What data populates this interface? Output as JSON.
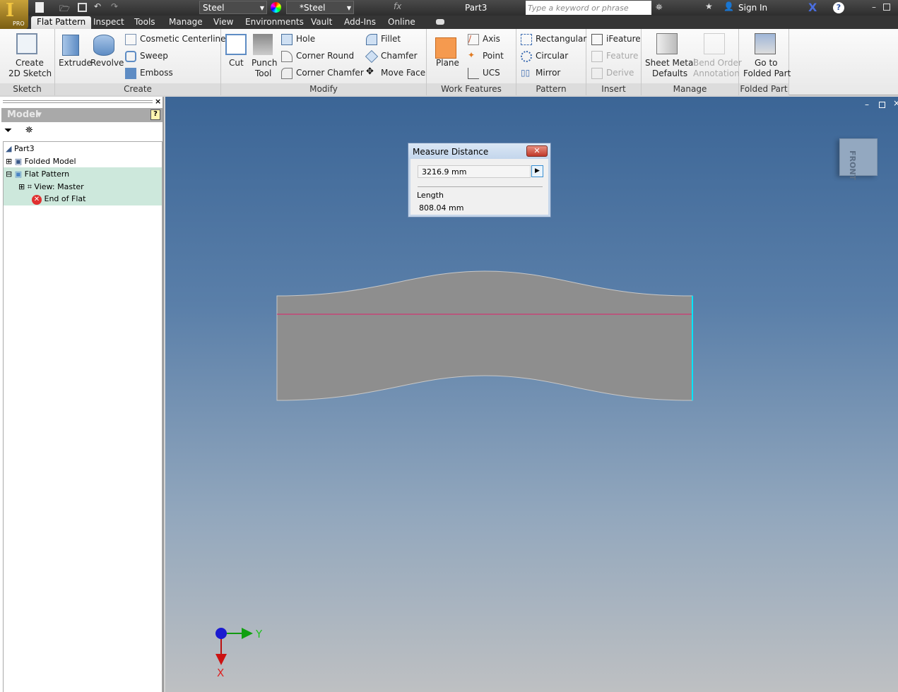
{
  "app": {
    "title": "Part3",
    "logo_badge": "PRO",
    "search_placeholder": "Type a keyword or phrase",
    "sign_in": "Sign In",
    "material": "Steel",
    "appearance": "*Steel"
  },
  "tabs": [
    {
      "label": "Flat Pattern",
      "active": true
    },
    {
      "label": "Inspect"
    },
    {
      "label": "Tools"
    },
    {
      "label": "Manage"
    },
    {
      "label": "View"
    },
    {
      "label": "Environments"
    },
    {
      "label": "Vault"
    },
    {
      "label": "Add-Ins"
    },
    {
      "label": "Online"
    }
  ],
  "ribbon": {
    "sketch": {
      "label": "Sketch",
      "create_sketch": [
        "Create",
        "2D Sketch"
      ]
    },
    "create": {
      "label": "Create",
      "extrude": "Extrude",
      "revolve": "Revolve",
      "cosmetic": "Cosmetic Centerline",
      "sweep": "Sweep",
      "emboss": "Emboss"
    },
    "modify": {
      "label": "Modify",
      "cut": "Cut",
      "punch": [
        "Punch",
        "Tool"
      ],
      "hole": "Hole",
      "corner_round": "Corner Round",
      "corner_chamfer": "Corner Chamfer",
      "fillet": "Fillet",
      "chamfer": "Chamfer",
      "move_face": "Move Face"
    },
    "work": {
      "label": "Work Features",
      "plane": "Plane",
      "axis": "Axis",
      "point": "Point",
      "ucs": "UCS"
    },
    "pattern": {
      "label": "Pattern",
      "rect": "Rectangular",
      "circ": "Circular",
      "mirror": "Mirror"
    },
    "insert": {
      "label": "Insert",
      "ifeature": "iFeature",
      "feature": "Feature",
      "derive": "Derive"
    },
    "manage": {
      "label": "Manage",
      "smd": [
        "Sheet Metal",
        "Defaults"
      ],
      "bend": [
        "Bend Order",
        "Annotation"
      ]
    },
    "folded": {
      "label": "Folded Part",
      "goto": [
        "Go to",
        "Folded Part"
      ]
    }
  },
  "browser": {
    "header": "Model",
    "items": [
      {
        "label": "Part3"
      },
      {
        "label": "Folded Model"
      },
      {
        "label": "Flat Pattern",
        "selected": true
      },
      {
        "label": "View: Master",
        "selected": true
      },
      {
        "label": "End of Flat",
        "selected": true
      }
    ]
  },
  "measure": {
    "title": "Measure Distance",
    "value": "3216.9 mm",
    "result_label": "Length",
    "result": "808.04 mm"
  },
  "viewcube": {
    "face": "FRONT"
  },
  "triad": {
    "x": "X",
    "y": "Y"
  },
  "colors": {
    "viewport_top": "#3b6596",
    "viewport_bottom": "#bec0c2",
    "part": "#8e8e8e",
    "measure_line": "#e0206a",
    "edge_highlight": "#00e5ff"
  }
}
